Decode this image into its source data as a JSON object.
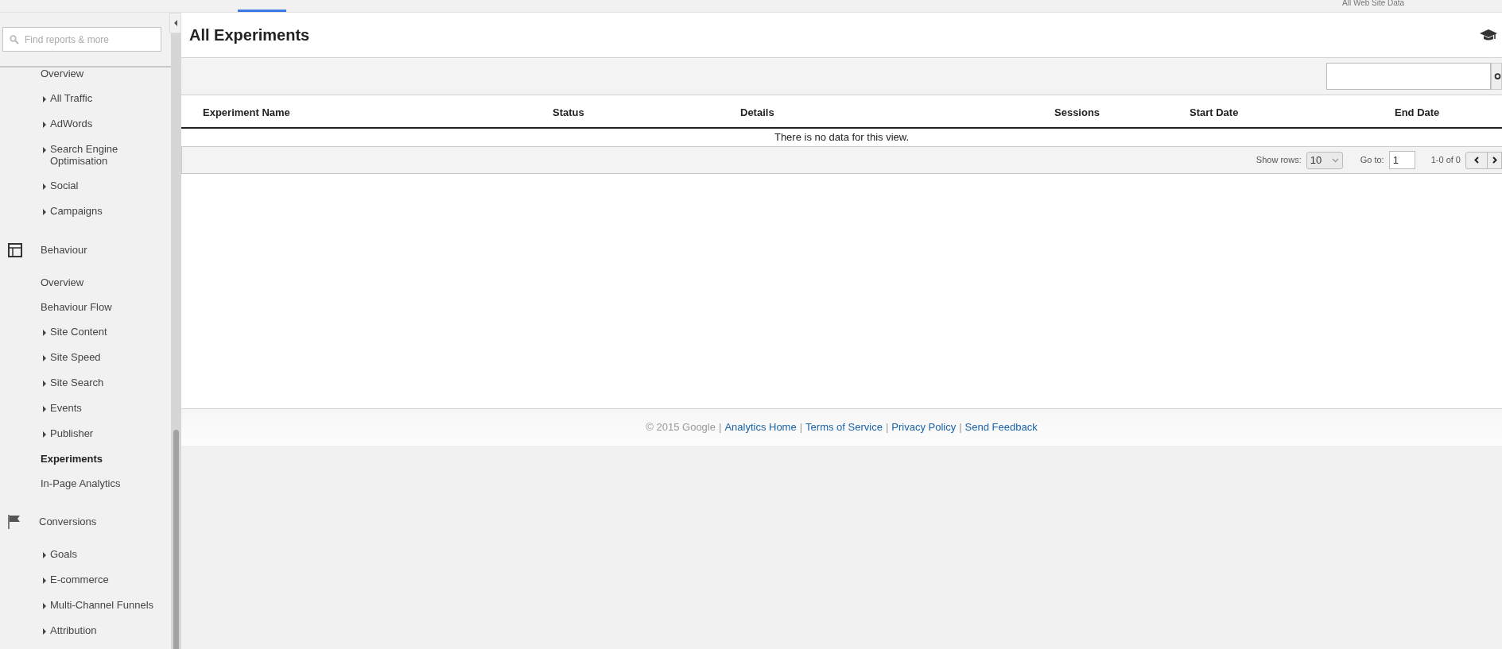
{
  "top_bar": {
    "view_label": "All Web Site Data"
  },
  "sidebar": {
    "search": {
      "placeholder": "Find reports & more"
    },
    "sections": [
      {
        "items": [
          {
            "label": "Overview",
            "expandable": false,
            "selected": false
          },
          {
            "label": "All Traffic",
            "expandable": true,
            "selected": false
          },
          {
            "label": "AdWords",
            "expandable": true,
            "selected": false
          },
          {
            "label": "Search Engine Optimisation",
            "expandable": true,
            "selected": false
          },
          {
            "label": "Social",
            "expandable": true,
            "selected": false
          },
          {
            "label": "Campaigns",
            "expandable": true,
            "selected": false
          }
        ]
      },
      {
        "title": "Behaviour",
        "kind": "behaviour",
        "items": [
          {
            "label": "Overview",
            "expandable": false,
            "selected": false
          },
          {
            "label": "Behaviour Flow",
            "expandable": false,
            "selected": false
          },
          {
            "label": "Site Content",
            "expandable": true,
            "selected": false
          },
          {
            "label": "Site Speed",
            "expandable": true,
            "selected": false
          },
          {
            "label": "Site Search",
            "expandable": true,
            "selected": false
          },
          {
            "label": "Events",
            "expandable": true,
            "selected": false
          },
          {
            "label": "Publisher",
            "expandable": true,
            "selected": false
          },
          {
            "label": "Experiments",
            "expandable": false,
            "selected": true
          },
          {
            "label": "In-Page Analytics",
            "expandable": false,
            "selected": false
          }
        ]
      },
      {
        "title": "Conversions",
        "kind": "conversions",
        "items": [
          {
            "label": "Goals",
            "expandable": true,
            "selected": false
          },
          {
            "label": "E-commerce",
            "expandable": true,
            "selected": false
          },
          {
            "label": "Multi-Channel Funnels",
            "expandable": true,
            "selected": false
          },
          {
            "label": "Attribution",
            "expandable": true,
            "selected": false
          }
        ]
      }
    ]
  },
  "page": {
    "title": "All Experiments"
  },
  "table": {
    "columns": [
      "Experiment Name",
      "Status",
      "Details",
      "Sessions",
      "Start Date",
      "End Date"
    ],
    "empty_message": "There is no data for this view."
  },
  "pager": {
    "show_rows_label": "Show rows:",
    "show_rows_value": "10",
    "goto_label": "Go to:",
    "goto_value": "1",
    "range": "1-0 of 0"
  },
  "footer": {
    "copyright": "© 2015 Google",
    "separator": "|",
    "links": [
      "Analytics Home",
      "Terms of Service",
      "Privacy Policy",
      "Send Feedback"
    ]
  }
}
